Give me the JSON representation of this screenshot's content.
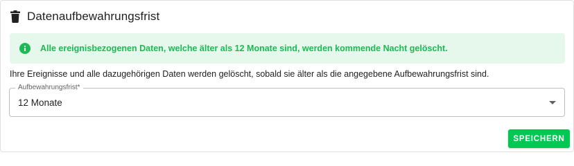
{
  "header": {
    "title": "Datenaufbewahrungsfrist",
    "icon": "trash-icon"
  },
  "alert": {
    "icon": "info-icon",
    "text": "Alle ereignisbezogenen Daten, welche älter als 12 Monate sind, werden kommende Nacht gelöscht.",
    "color": "#1db954",
    "background": "#e6f7ec"
  },
  "description": "Ihre Ereignisse und alle dazugehörigen Daten werden gelöscht, sobald sie älter als die angegebene Aufbewahrungsfrist sind.",
  "retention_select": {
    "label": "Aufbewahrungsfrist*",
    "value": "12 Monate"
  },
  "actions": {
    "save_label": "SPEICHERN",
    "save_color": "#00c853"
  }
}
